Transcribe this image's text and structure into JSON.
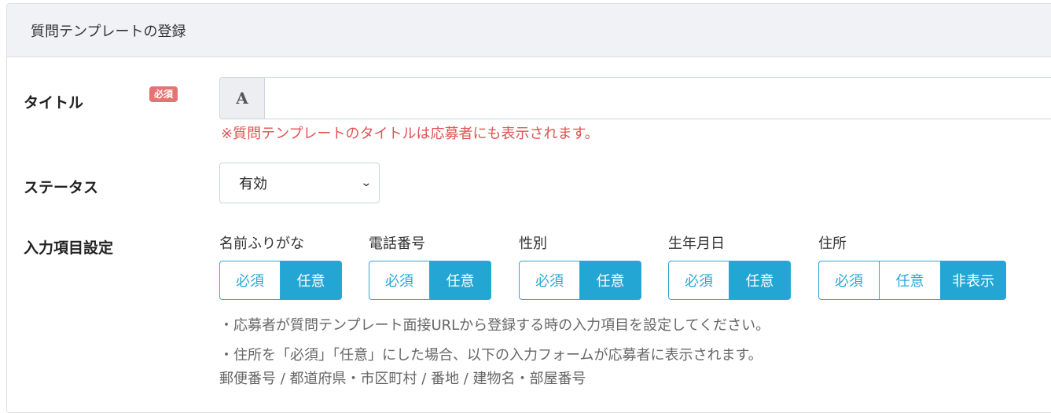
{
  "header": {
    "title": "質問テンプレートの登録"
  },
  "title_field": {
    "label": "タイトル",
    "required_badge": "必須",
    "prefix_icon_glyph": "A",
    "value": "",
    "note": "※質問テンプレートのタイトルは応募者にも表示されます。"
  },
  "status_field": {
    "label": "ステータス",
    "selected": "有効"
  },
  "input_settings": {
    "label": "入力項目設定",
    "fields": [
      {
        "name": "名前ふりがな",
        "options": [
          "必須",
          "任意"
        ],
        "selected": "任意"
      },
      {
        "name": "電話番号",
        "options": [
          "必須",
          "任意"
        ],
        "selected": "任意"
      },
      {
        "name": "性別",
        "options": [
          "必須",
          "任意"
        ],
        "selected": "任意"
      },
      {
        "name": "生年月日",
        "options": [
          "必須",
          "任意"
        ],
        "selected": "任意"
      },
      {
        "name": "住所",
        "options": [
          "必須",
          "任意",
          "非表示"
        ],
        "selected": "非表示"
      }
    ],
    "help_1": "・応募者が質問テンプレート面接URLから登録する時の入力項目を設定してください。",
    "help_2": "・住所を「必須」「任意」にした場合、以下の入力フォームが応募者に表示されます。",
    "help_3": "郵便番号 / 都道府県・市区町村 / 番地 / 建物名・部屋番号"
  },
  "colors": {
    "accent": "#24a6d4",
    "required_badge": "#e57373",
    "note_red": "#e05252",
    "header_bg": "#f0f2f5"
  }
}
